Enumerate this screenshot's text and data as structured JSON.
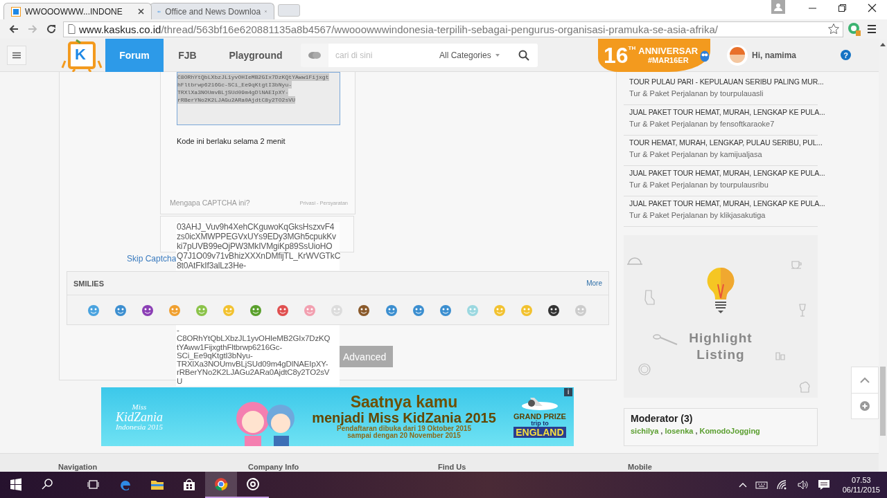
{
  "browser": {
    "tabs": [
      {
        "title": "WWOOOWWW...INDONE",
        "selected": true
      },
      {
        "title": "Office and News Downloa",
        "selected": false
      }
    ],
    "address": {
      "host": "www.kaskus.co.id",
      "path": "/thread/563bf16e620881135a8b4567/wwooowwwindonesia-terpilih-sebagai-pengurus-organisasi-pramuka-se-asia-afrika/"
    }
  },
  "site_header": {
    "logo": "K",
    "nav": [
      {
        "label": "Forum",
        "selected": true
      },
      {
        "label": "FJB",
        "selected": false
      },
      {
        "label": "Playground",
        "selected": false
      }
    ],
    "search": {
      "placeholder": "cari di sini",
      "category": "All Categories"
    },
    "anniversary": {
      "number": "16",
      "suffix": "TH",
      "title": "ANNIVERSAR",
      "hashtag": "#MAR16ER"
    },
    "greeting": "Hi, namima",
    "help": "?"
  },
  "captcha": {
    "token_lines": [
      "C8ORhYtQbLXbzJL1yvOHIeMB2GIx7DzKQtYAww1Fijxgt",
      "hFltbrwp6216Gc-SCi_Ee9qKtgtI3bNyu-",
      "TRXlXa3NOUmvBLjSUd09m4gDlNAEIpXY-",
      "rRBerYNo2K2LJAGu2ARa0AjdtC8y2TO2sVU"
    ],
    "note": "Kode ini berlaku selama 2 menit",
    "why_link": "Mengapa CAPTCHA ini?",
    "privacy_link": "Privasi",
    "separator": "-",
    "terms_link": "Persyaratan",
    "response_top": [
      "03AHJ_Vuv9h4XehCKguwoKqGksHszxvF4",
      "zs0icXMWPPEGVxUYs9EDy3MGh5cpukKv",
      "ki7pUVB99eOjPW3MkIVMgiKp89SsUioHO",
      "Q7J1O09v71vBhizXXXnDMfijTL_KrWVGTkC",
      "8t0AtFkIf3alLz3He-"
    ],
    "response_bottom": [
      "-",
      "C8ORhYtQbLXbzJL1yvOHIeMB2GIx7DzKQ",
      "tYAww1FijxgthFltbrwp6216Gc-",
      "SCi_Ee9qKtgtI3bNyu-",
      "TRXlXa3NOUmvBLjSUd09m4gDlNAEIpXY-",
      "rRBerYNo2K2LJAGu2ARa0AjdtC8y2TO2sV",
      "U"
    ],
    "skip_link": "Skip Captcha"
  },
  "smilies": {
    "title": "SMILIES",
    "more_link": "More"
  },
  "advanced_button": "Advanced",
  "ad_banner": {
    "logo_lines": [
      "Miss",
      "KidZania",
      "Indonesia 2015"
    ],
    "headline": "Saatnya kamu",
    "subheadline": "menjadi Miss KidZania 2015",
    "details": [
      "Pendaftaran dibuka dari 19 Oktober 2015",
      "sampai dengan 20 November 2015"
    ],
    "prize_lines": [
      "GRAND PRIZE",
      "trip to",
      "ENGLAND"
    ],
    "info": "i"
  },
  "sidebar": {
    "threads": [
      {
        "title": "TOUR PULAU PARI - KEPULAUAN SERIBU PALING MUR...",
        "subtitle": "Tur & Paket Perjalanan by tourpulauasli"
      },
      {
        "title": "JUAL PAKET TOUR HEMAT, MURAH, LENGKAP KE PULA...",
        "subtitle": "Tur & Paket Perjalanan by fensoftkaraoke7"
      },
      {
        "title": "TOUR HEMAT, MURAH, LENGKAP, PULAU SERIBU, PUL...",
        "subtitle": "Tur & Paket Perjalanan by kamijualjasa"
      },
      {
        "title": "JUAL PAKET TOUR HEMAT, MURAH, LENGKAP KE PULA...",
        "subtitle": "Tur & Paket Perjalanan by tourpulausribu"
      },
      {
        "title": "JUAL PAKET TOUR HEMAT, MURAH, LENGKAP KE PULA...",
        "subtitle": "Tur & Paket Perjalanan by klikjasakutiga"
      }
    ],
    "highlight": [
      "Highlight",
      "Listing"
    ],
    "moderators": {
      "title": "Moderator (3)",
      "names": [
        "sichilya",
        "losenka",
        "KomodoJogging"
      ],
      "separator": ","
    }
  },
  "footer": {
    "columns": [
      "Navigation",
      "Company Info",
      "Find Us",
      "Mobile"
    ]
  },
  "taskbar": {
    "apps": [
      {
        "kind": "edge",
        "selected": false,
        "running": false
      },
      {
        "kind": "explorer",
        "selected": false,
        "running": false
      },
      {
        "kind": "store",
        "selected": false,
        "running": false
      },
      {
        "kind": "chrome",
        "selected": true,
        "running": true
      },
      {
        "kind": "media",
        "selected": false,
        "running": true
      }
    ],
    "time": "07.53",
    "date": "06/11/2015"
  }
}
